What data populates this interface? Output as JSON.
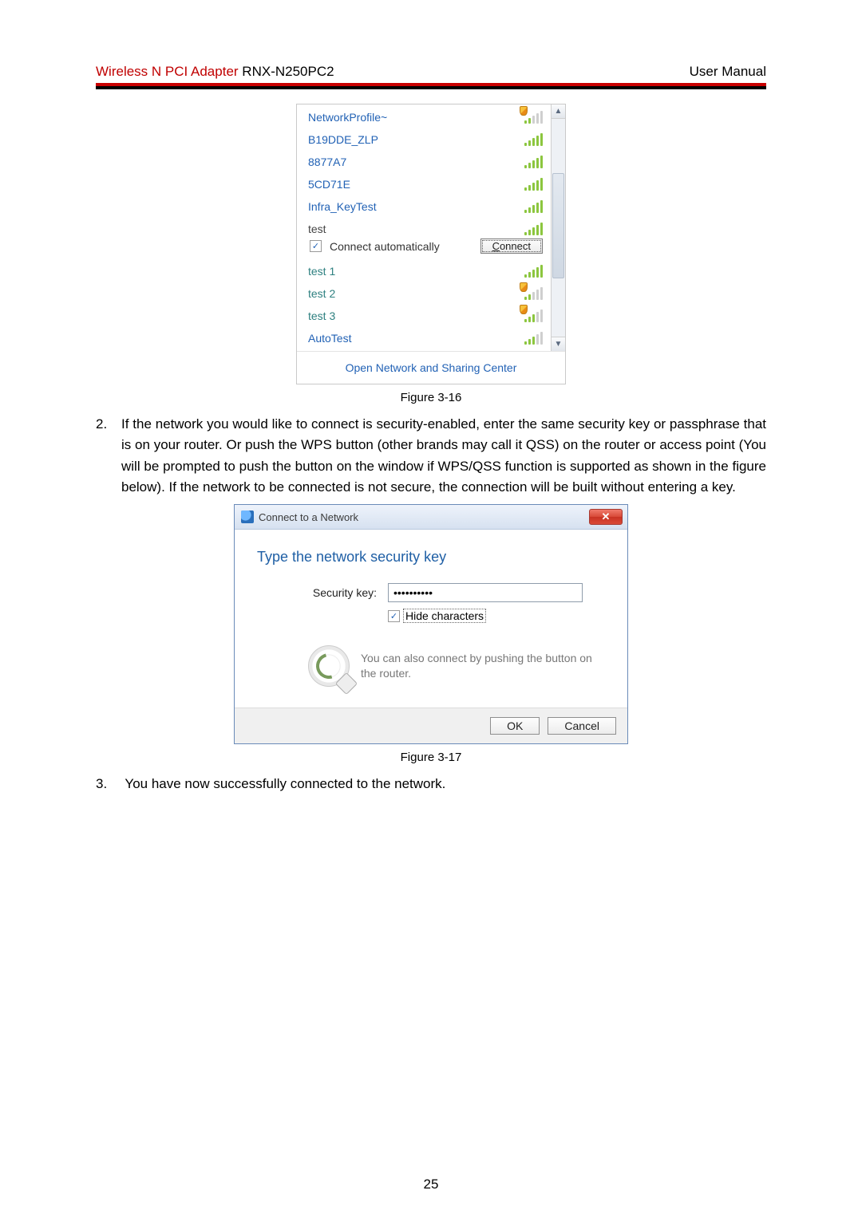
{
  "header": {
    "accent_text": "Wireless N PCI Adapter",
    "model": "RNX-N250PC2",
    "right": "User Manual"
  },
  "flyout": {
    "networks": [
      {
        "name": "NetworkProfile~",
        "strength": "weak3",
        "shield": true,
        "color": "blue"
      },
      {
        "name": "B19DDE_ZLP",
        "strength": "full",
        "shield": false,
        "color": "blue"
      },
      {
        "name": "8877A7",
        "strength": "full",
        "shield": false,
        "color": "blue"
      },
      {
        "name": "5CD71E",
        "strength": "full",
        "shield": false,
        "color": "blue"
      },
      {
        "name": "Infra_KeyTest",
        "strength": "full",
        "shield": false,
        "color": "blue"
      }
    ],
    "selected": {
      "name": "test",
      "auto_label": "Connect automatically",
      "auto_checked": true,
      "connect_label": "Connect"
    },
    "networks_after": [
      {
        "name": "test 1",
        "strength": "full",
        "shield": false,
        "color": "teal"
      },
      {
        "name": "test 2",
        "strength": "weak3",
        "shield": true,
        "color": "teal"
      },
      {
        "name": "test 3",
        "strength": "weak",
        "shield": true,
        "color": "teal"
      },
      {
        "name": "AutoTest",
        "strength": "weak",
        "shield": false,
        "color": "blue"
      }
    ],
    "footer_link": "Open Network and Sharing Center"
  },
  "captions": {
    "fig1": "Figure 3-16",
    "fig2": "Figure 3-17"
  },
  "body": {
    "item2_num": "2.",
    "item2_text": "If the network you would like to connect is security-enabled, enter the same security key or passphrase that is on your router. Or push the WPS button (other brands may call it QSS) on the router or access point (You will be prompted to push the button on the window if WPS/QSS function is supported as shown in the figure below). If the network to be connected is not secure, the connection will be built without entering a key.",
    "item3_num": "3.",
    "item3_text": "You have now successfully connected to the network."
  },
  "dialog": {
    "title": "Connect to a Network",
    "heading": "Type the network security key",
    "label": "Security key:",
    "value": "••••••••••",
    "hide_label": "Hide characters",
    "hide_checked": true,
    "wps_text": "You can also connect by pushing the button on the router.",
    "ok": "OK",
    "cancel": "Cancel"
  },
  "page_number": "25"
}
